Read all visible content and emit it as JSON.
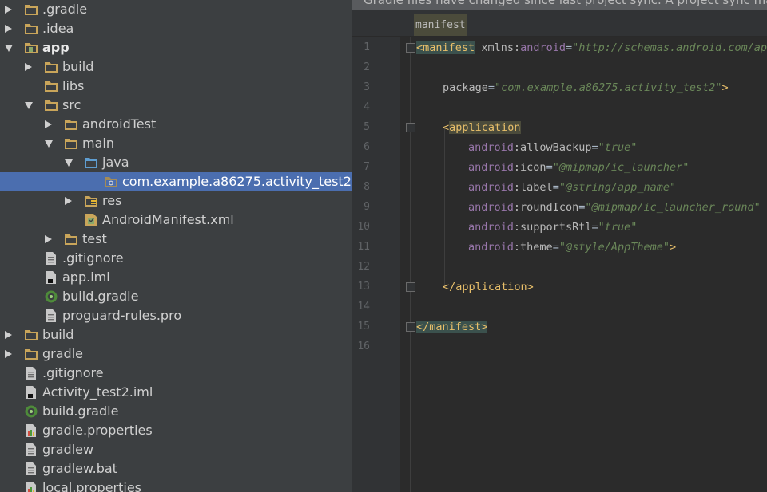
{
  "tree": {
    "items": [
      {
        "label": ".gradle",
        "icon": "folder-icon",
        "arrow": "right",
        "bold": false
      },
      {
        "label": ".idea",
        "icon": "folder-icon",
        "arrow": "right",
        "bold": false
      },
      {
        "label": "app",
        "icon": "module-icon",
        "arrow": "down",
        "bold": true
      },
      {
        "label": "build",
        "icon": "folder-icon",
        "arrow": "right",
        "bold": false
      },
      {
        "label": "libs",
        "icon": "folder-icon",
        "arrow": "none",
        "bold": false
      },
      {
        "label": "src",
        "icon": "folder-icon",
        "arrow": "down",
        "bold": false
      },
      {
        "label": "androidTest",
        "icon": "folder-icon",
        "arrow": "right",
        "bold": false
      },
      {
        "label": "main",
        "icon": "folder-icon",
        "arrow": "down",
        "bold": false
      },
      {
        "label": "java",
        "icon": "source-folder-icon",
        "arrow": "down",
        "bold": false
      },
      {
        "label": "com.example.a86275.activity_test2",
        "icon": "package-icon",
        "arrow": "none",
        "bold": false,
        "selected": true
      },
      {
        "label": "res",
        "icon": "resource-folder-icon",
        "arrow": "right",
        "bold": false
      },
      {
        "label": "AndroidManifest.xml",
        "icon": "manifest-icon",
        "arrow": "none",
        "bold": false
      },
      {
        "label": "test",
        "icon": "folder-icon",
        "arrow": "right",
        "bold": false
      },
      {
        "label": ".gitignore",
        "icon": "text-file-icon",
        "arrow": "none",
        "bold": false
      },
      {
        "label": "app.iml",
        "icon": "iml-file-icon",
        "arrow": "none",
        "bold": false
      },
      {
        "label": "build.gradle",
        "icon": "gradle-icon",
        "arrow": "none",
        "bold": false
      },
      {
        "label": "proguard-rules.pro",
        "icon": "text-file-icon",
        "arrow": "none",
        "bold": false
      },
      {
        "label": "build",
        "icon": "folder-icon",
        "arrow": "right",
        "bold": false
      },
      {
        "label": "gradle",
        "icon": "folder-icon",
        "arrow": "right",
        "bold": false
      },
      {
        "label": ".gitignore",
        "icon": "text-file-icon",
        "arrow": "none",
        "bold": false
      },
      {
        "label": "Activity_test2.iml",
        "icon": "iml-file-icon",
        "arrow": "none",
        "bold": false
      },
      {
        "label": "build.gradle",
        "icon": "gradle-icon",
        "arrow": "none",
        "bold": false
      },
      {
        "label": "gradle.properties",
        "icon": "properties-file-icon",
        "arrow": "none",
        "bold": false
      },
      {
        "label": "gradlew",
        "icon": "text-file-icon",
        "arrow": "none",
        "bold": false
      },
      {
        "label": "gradlew.bat",
        "icon": "text-file-icon",
        "arrow": "none",
        "bold": false
      },
      {
        "label": "local.properties",
        "icon": "properties-file-icon",
        "arrow": "none",
        "bold": false
      }
    ]
  },
  "editor": {
    "notice": "Gradle files have changed since last project sync. A project sync may be",
    "breadcrumb": "manifest",
    "line_numbers": [
      "1",
      "2",
      "3",
      "4",
      "5",
      "6",
      "7",
      "8",
      "9",
      "10",
      "11",
      "12",
      "13",
      "14",
      "15",
      "16"
    ],
    "lines": {
      "l1": {
        "open": "<",
        "tag": "manifest",
        "sp": " ",
        "attr": "xmlns:",
        "ns": "android",
        "eq": "=",
        "val": "\"http://schemas.android.com/apk/res/android\""
      },
      "l3": {
        "attr": "package",
        "eq": "=",
        "val": "\"com.example.a86275.activity_test2\"",
        "close": ">"
      },
      "l5": {
        "open": "<",
        "tag": "application"
      },
      "l6": {
        "ns": "android",
        "colon": ":",
        "attr": "allowBackup",
        "eq": "=",
        "val": "\"true\""
      },
      "l7": {
        "ns": "android",
        "colon": ":",
        "attr": "icon",
        "eq": "=",
        "val": "\"@mipmap/ic_launcher\""
      },
      "l8": {
        "ns": "android",
        "colon": ":",
        "attr": "label",
        "eq": "=",
        "val": "\"@string/app_name\""
      },
      "l9": {
        "ns": "android",
        "colon": ":",
        "attr": "roundIcon",
        "eq": "=",
        "val": "\"@mipmap/ic_launcher_round\""
      },
      "l10": {
        "ns": "android",
        "colon": ":",
        "attr": "supportsRtl",
        "eq": "=",
        "val": "\"true\""
      },
      "l11": {
        "ns": "android",
        "colon": ":",
        "attr": "theme",
        "eq": "=",
        "val": "\"@style/AppTheme\"",
        "close": ">"
      },
      "l13": {
        "text": "</application>"
      },
      "l15": {
        "text": "</manifest>"
      }
    }
  },
  "colors": {
    "tree_bg": "#3c3f41",
    "selection": "#4b6eaf",
    "editor_bg": "#2b2b2b",
    "tag": "#e8bf6a",
    "string": "#6a8759",
    "namespace": "#9876aa"
  }
}
